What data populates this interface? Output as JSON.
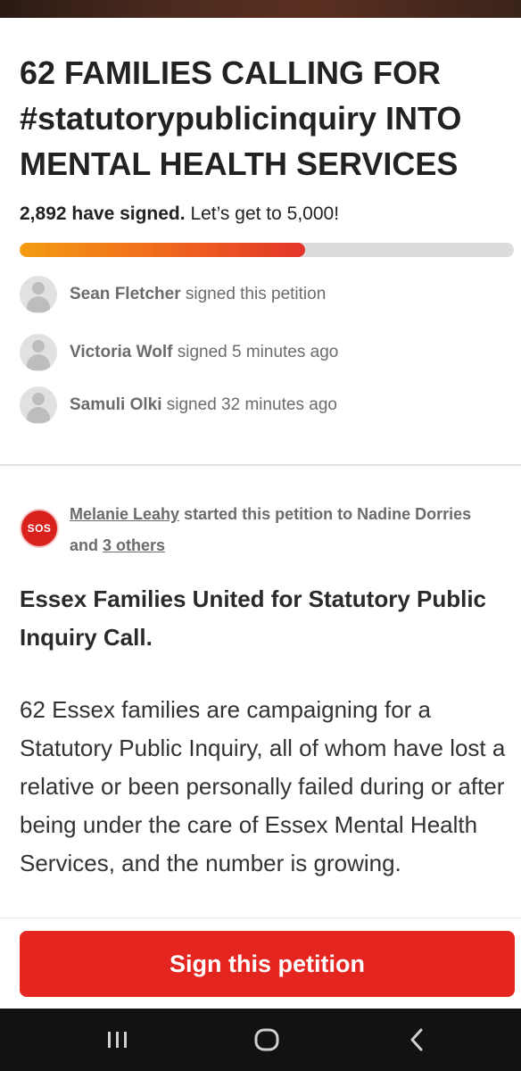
{
  "petition": {
    "title": "62 FAMILIES CALLING FOR #statutorypublicinquiry INTO MENTAL HEALTH SERVICES",
    "signed_count": "2,892 have signed.",
    "goal_text": "Let’s get to 5,000!",
    "progress_fraction": 0.5784
  },
  "recent_signers": [
    {
      "name": "Sean Fletcher",
      "action": "signed this petition"
    },
    {
      "name": "Victoria Wolf",
      "action": "signed 5 minutes ago"
    },
    {
      "name": "Samuli Olki",
      "action": "signed 32 minutes ago"
    }
  ],
  "starter": {
    "logo_text": "SOS",
    "name": "Melanie Leahy",
    "action": "started this petition to Nadine Dorries and",
    "others_link": "3 others"
  },
  "content": {
    "heading": "Essex Families United for Statutory Public Inquiry Call.",
    "body": "62 Essex families are campaigning for a Statutory Public Inquiry, all of whom have lost a relative or been personally failed  during or after being under the care of Essex Mental Health Services,  and the number is growing."
  },
  "cta": {
    "label": "Sign this petition"
  },
  "colors": {
    "accent_red": "#e5251f",
    "progress_start": "#f39c12",
    "progress_end": "#e3342a",
    "nav_bar": "#121212"
  },
  "nav": {
    "icons": [
      "recents-icon",
      "home-icon",
      "back-icon"
    ]
  }
}
